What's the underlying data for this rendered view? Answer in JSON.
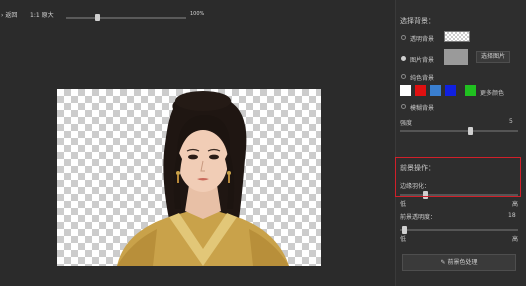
{
  "toolbar": {
    "back_label": "返回",
    "zoom_label": "1:1 原大",
    "zoom_value": "100%",
    "zoom_level": 0.25
  },
  "panel": {
    "bg_section_title": "选择背景：",
    "option_transparent": "透明背景",
    "option_image": "图片背景",
    "select_image_button": "选择图片",
    "option_solid": "纯色背景",
    "more_colors": "更多颜色",
    "option_blur": "模糊背景",
    "blur_label": "强度",
    "blur_value": "5",
    "blur_level": 0.6,
    "fg_section_title": "前景操作：",
    "edge_label": "边缘羽化：",
    "edge_low": "低",
    "edge_high": "高",
    "edge_level": 0.2,
    "opacity_label": "前景透明度：",
    "opacity_value": "18",
    "opacity_level": 0.02,
    "opacity_low": "低",
    "opacity_high": "高",
    "restore_button": "前景色处理"
  },
  "colors": {
    "swatches": [
      "#ffffff",
      "#e01010",
      "#3a7fd0",
      "#1020e0",
      "#20c020"
    ],
    "highlight": "#d0202a"
  }
}
